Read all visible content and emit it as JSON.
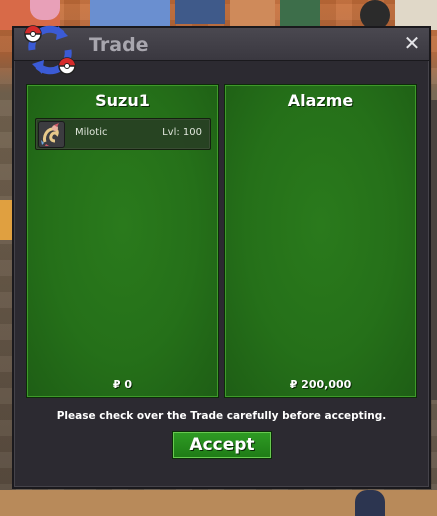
{
  "window": {
    "title": "Trade",
    "close_glyph": "✕"
  },
  "left_panel": {
    "player": "Suzu1",
    "items": [
      {
        "pokemon": "Milotic",
        "level": "Lvl: 100",
        "icon": "milotic-sprite-icon"
      }
    ],
    "money": "₽ 0"
  },
  "right_panel": {
    "player": "Alazme",
    "items": [],
    "money": "₽ 200,000"
  },
  "notice": "Please check over the Trade carefully before accepting.",
  "accept_label": "Accept",
  "colors": {
    "panel_green": "#257019",
    "button_green": "#2f9c24",
    "window_bg": "#2c2a31",
    "pokeball_red": "#d62b2b",
    "arrow_blue": "#3b5bd6"
  }
}
